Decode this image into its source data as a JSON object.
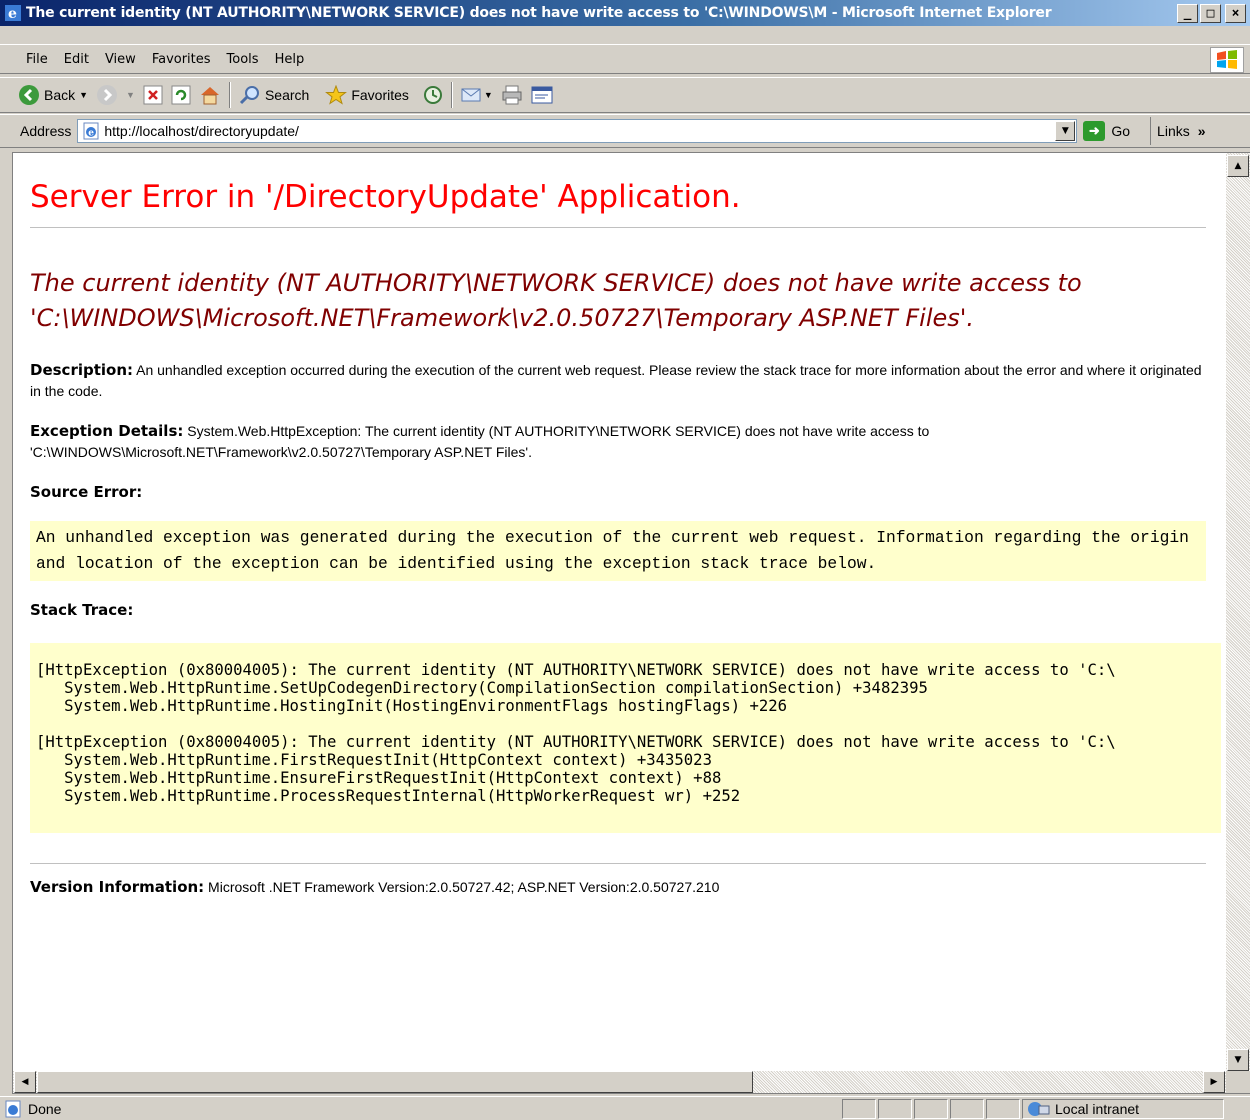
{
  "window": {
    "title": "The current identity (NT AUTHORITY\\NETWORK SERVICE) does not have write access to 'C:\\WINDOWS\\M - Microsoft Internet Explorer",
    "minimize": "_",
    "maximize": "□",
    "close": "×"
  },
  "menu": {
    "items": [
      "File",
      "Edit",
      "View",
      "Favorites",
      "Tools",
      "Help"
    ]
  },
  "toolbar": {
    "back_label": "Back",
    "search_label": "Search",
    "favorites_label": "Favorites"
  },
  "address": {
    "label": "Address",
    "url": "http://localhost/directoryupdate/",
    "go_label": "Go",
    "links_label": "Links",
    "links_more": "»"
  },
  "page": {
    "title": "Server Error in '/DirectoryUpdate' Application.",
    "error_message": "The current identity (NT AUTHORITY\\NETWORK SERVICE) does not have write access to 'C:\\WINDOWS\\Microsoft.NET\\Framework\\v2.0.50727\\Temporary ASP.NET Files'.",
    "description_label": "Description:",
    "description_text": " An unhandled exception occurred during the execution of the current web request. Please review the stack trace for more information about the error and where it originated in the code.",
    "exception_label": "Exception Details:",
    "exception_text": " System.Web.HttpException: The current identity (NT AUTHORITY\\NETWORK SERVICE) does not have write access to 'C:\\WINDOWS\\Microsoft.NET\\Framework\\v2.0.50727\\Temporary ASP.NET Files'.",
    "source_error_label": "Source Error:",
    "source_error_text": "An unhandled exception was generated during the execution of the current web request. Information regarding the origin and location of the exception can be identified using the exception stack trace below.",
    "stack_trace_label": "Stack Trace:",
    "stack_trace_block1": [
      "[HttpException (0x80004005): The current identity (NT AUTHORITY\\NETWORK SERVICE) does not have write access to 'C:\\",
      "   System.Web.HttpRuntime.SetUpCodegenDirectory(CompilationSection compilationSection) +3482395",
      "   System.Web.HttpRuntime.HostingInit(HostingEnvironmentFlags hostingFlags) +226"
    ],
    "stack_trace_block2": [
      "[HttpException (0x80004005): The current identity (NT AUTHORITY\\NETWORK SERVICE) does not have write access to 'C:\\",
      "   System.Web.HttpRuntime.FirstRequestInit(HttpContext context) +3435023",
      "   System.Web.HttpRuntime.EnsureFirstRequestInit(HttpContext context) +88",
      "   System.Web.HttpRuntime.ProcessRequestInternal(HttpWorkerRequest wr) +252"
    ],
    "version_label": "Version Information:",
    "version_text": " Microsoft .NET Framework Version:2.0.50727.42; ASP.NET Version:2.0.50727.210"
  },
  "status": {
    "text": "Done",
    "zone": "Local intranet"
  },
  "colors": {
    "title_red": "#ff0000",
    "error_maroon": "#800000",
    "code_background": "#ffffcc",
    "titlebar_blue": "#0a246a"
  },
  "icons": {
    "title": "ie-logo-icon",
    "back": "back-arrow-icon",
    "forward": "forward-arrow-icon",
    "stop": "stop-icon",
    "refresh": "refresh-icon",
    "home": "home-icon",
    "search": "magnifier-icon",
    "favorites": "star-icon",
    "history": "history-icon",
    "mail": "mail-icon",
    "print": "printer-icon",
    "edit": "edit-icon"
  }
}
